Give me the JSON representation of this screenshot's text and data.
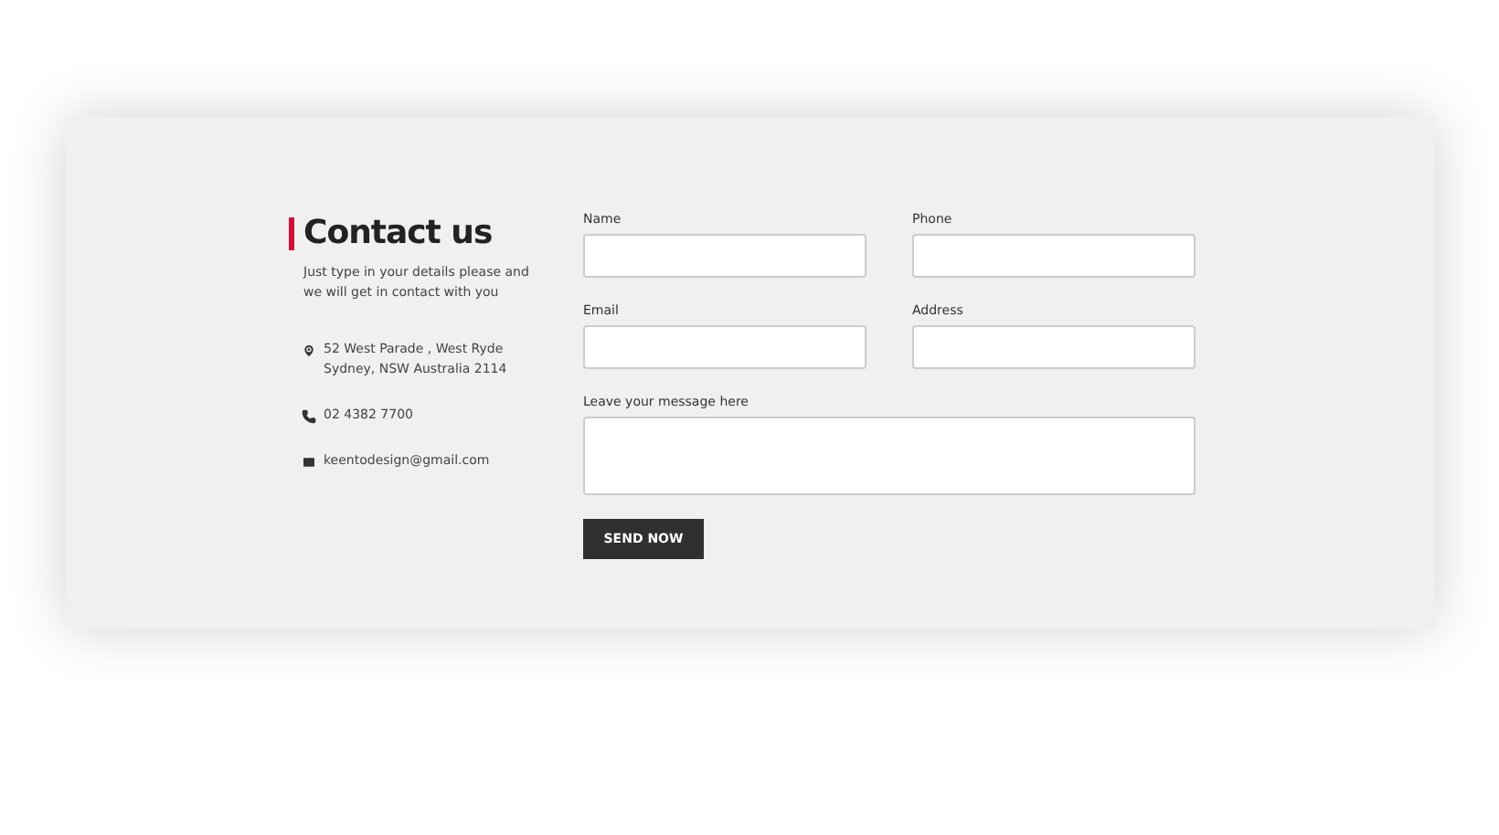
{
  "heading": {
    "title": "Contact us",
    "intro": "Just type in your details please and we will get in contact with you"
  },
  "contacts": [
    {
      "kind": "address",
      "lines": [
        "52 West Parade , West Ryde",
        "Sydney, NSW Australia 2114"
      ]
    },
    {
      "kind": "phone",
      "lines": [
        "02 4382 7700"
      ]
    },
    {
      "kind": "email",
      "lines": [
        "keentodesign@gmail.com"
      ]
    }
  ],
  "fields": [
    {
      "label": "Name",
      "kind": "input"
    },
    {
      "label": "Phone",
      "kind": "input"
    },
    {
      "label": "Email",
      "kind": "input"
    },
    {
      "label": "Address",
      "kind": "input"
    },
    {
      "label": "Leave your message here",
      "kind": "textarea"
    }
  ],
  "submit": "SEND NOW"
}
